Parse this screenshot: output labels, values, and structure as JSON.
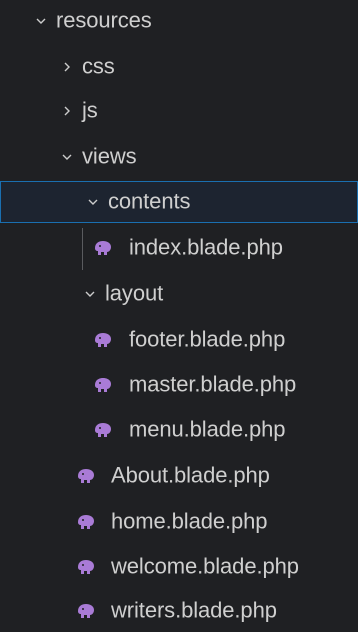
{
  "icons": {
    "chevron_down": "chevron-down-icon",
    "chevron_right": "chevron-right-icon",
    "php_elephant": "php-elephant-icon"
  },
  "colors": {
    "background": "#1f2023",
    "text": "#cfcfcf",
    "selected_border": "#1a6fb0",
    "php_icon": "#a97bd6"
  },
  "tree": {
    "resources": {
      "label": "resources"
    },
    "css": {
      "label": "css"
    },
    "js": {
      "label": "js"
    },
    "views": {
      "label": "views"
    },
    "contents": {
      "label": "contents"
    },
    "contents_index": {
      "label": "index.blade.php"
    },
    "layout": {
      "label": "layout"
    },
    "layout_footer": {
      "label": "footer.blade.php"
    },
    "layout_master": {
      "label": "master.blade.php"
    },
    "layout_menu": {
      "label": "menu.blade.php"
    },
    "about": {
      "label": "About.blade.php"
    },
    "home": {
      "label": "home.blade.php"
    },
    "welcome": {
      "label": "welcome.blade.php"
    },
    "writers": {
      "label": "writers.blade.php"
    }
  }
}
